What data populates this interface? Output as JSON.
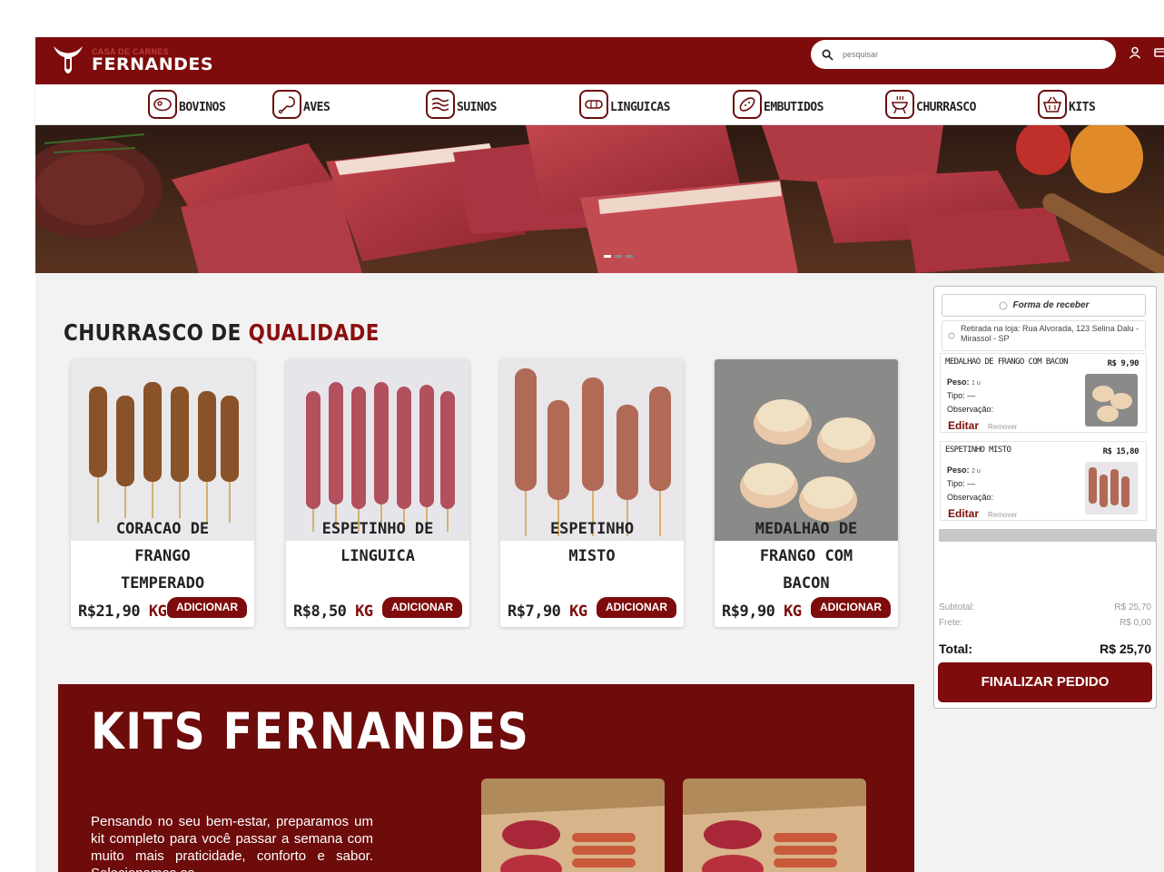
{
  "header": {
    "logo_top": "CASA DE CARNES",
    "logo_main": "FERNANDES",
    "search_placeholder": "pesquisar",
    "brand_color": "#7e0c0c",
    "icons": [
      "search-icon",
      "user-icon",
      "cart-icon"
    ]
  },
  "categories": [
    {
      "label": "BOVINOS",
      "icon": "steak-icon"
    },
    {
      "label": "AVES",
      "icon": "chicken-leg-icon"
    },
    {
      "label": "SUINOS",
      "icon": "bacon-icon"
    },
    {
      "label": "LINGUICAS",
      "icon": "sausage-icon"
    },
    {
      "label": "EMBUTIDOS",
      "icon": "salami-icon"
    },
    {
      "label": "CHURRASCO",
      "icon": "grill-icon"
    },
    {
      "label": "KITS",
      "icon": "basket-icon"
    }
  ],
  "banner": {
    "slides": 3,
    "active_slide": 1
  },
  "section": {
    "title_part1": "CHURRASCO DE ",
    "title_part2": "QUALIDADE"
  },
  "products": [
    {
      "name": "CORACAO DE FRANGO TEMPERADO",
      "price": "R$21,90",
      "unit": "KG",
      "button": "ADICIONAR"
    },
    {
      "name": "ESPETINHO DE LINGUICA",
      "price": "R$8,50",
      "unit": "KG",
      "button": "ADICIONAR"
    },
    {
      "name": "ESPETINHO MISTO",
      "price": "R$7,90",
      "unit": "KG",
      "button": "ADICIONAR"
    },
    {
      "name": "MEDALHAO DE FRANGO COM BACON",
      "price": "R$9,90",
      "unit": "KG",
      "button": "ADICIONAR"
    }
  ],
  "kits": {
    "title": "KITS FERNANDES",
    "text": "Pensando no seu bem-estar, preparamos um kit completo para você passar a semana com muito mais praticidade, conforto e sabor. Selecionamos os"
  },
  "cart": {
    "receive_label": "Forma de receber",
    "pickup_text": "Retirada na loja: Rua Alvorada, 123 Selina Dalu - Mirassol - SP",
    "items": [
      {
        "name": "MEDALHAO DE FRANGO COM BACON",
        "price": "R$ 9,90",
        "peso_label": "Peso:",
        "peso": "1 u",
        "tipo_label": "Tipo:",
        "tipo": "—",
        "obs_label": "Observação:",
        "edit": "Editar",
        "remove": "Remover"
      },
      {
        "name": "ESPETINHO MISTO",
        "price": "R$ 15,80",
        "peso_label": "Peso:",
        "peso": "2 u",
        "tipo_label": "Tipo:",
        "tipo": "—",
        "obs_label": "Observação:",
        "edit": "Editar",
        "remove": "Remover"
      }
    ],
    "subtotal_label": "Subtotal:",
    "subtotal": "R$ 25,70",
    "frete_label": "Frete:",
    "frete": "R$ 0,00",
    "total_label": "Total:",
    "total": "R$ 25,70",
    "checkout": "FINALIZAR PEDIDO"
  }
}
